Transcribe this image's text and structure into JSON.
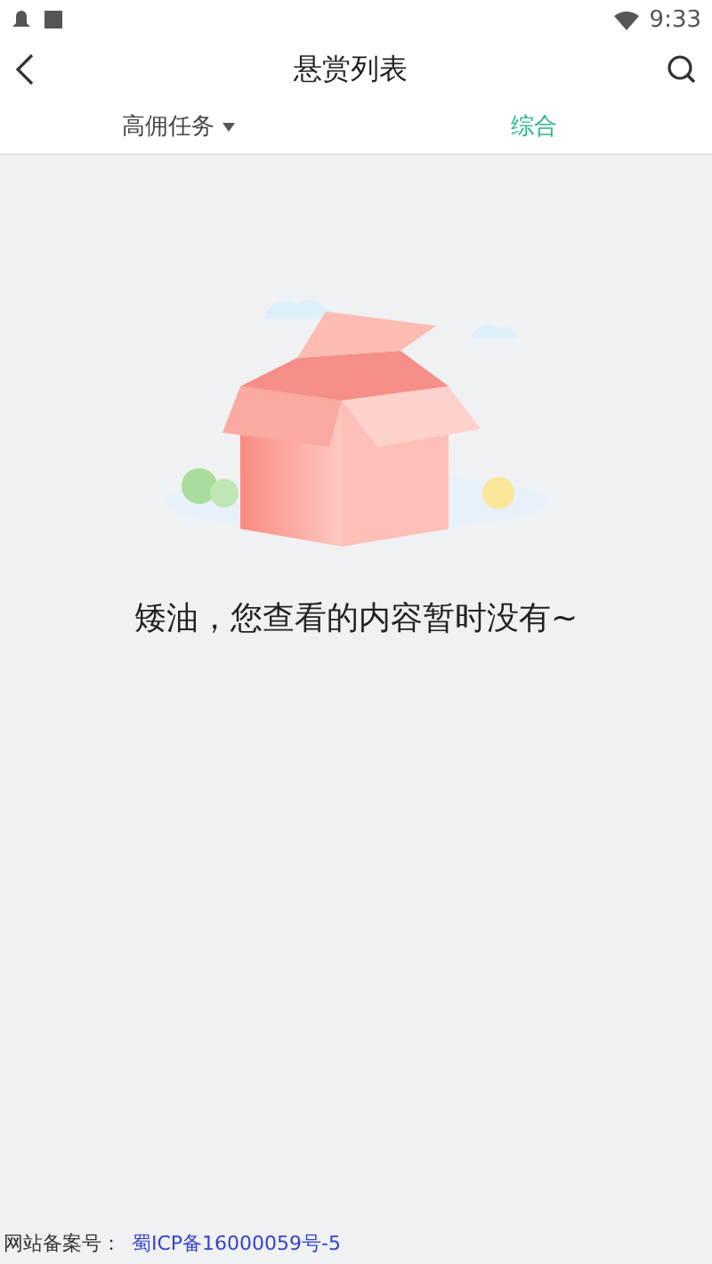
{
  "status_bar": {
    "time": "9:33"
  },
  "header": {
    "title": "悬赏列表"
  },
  "tabs": [
    {
      "label": "高佣任务",
      "kind": "dropdown",
      "selected": false
    },
    {
      "label": "综合",
      "kind": "plain",
      "selected": true
    }
  ],
  "empty_state": {
    "message": "矮油，您查看的内容暂时没有~"
  },
  "footer": {
    "label": "网站备案号：",
    "link": "蜀ICP备16000059号-5"
  }
}
